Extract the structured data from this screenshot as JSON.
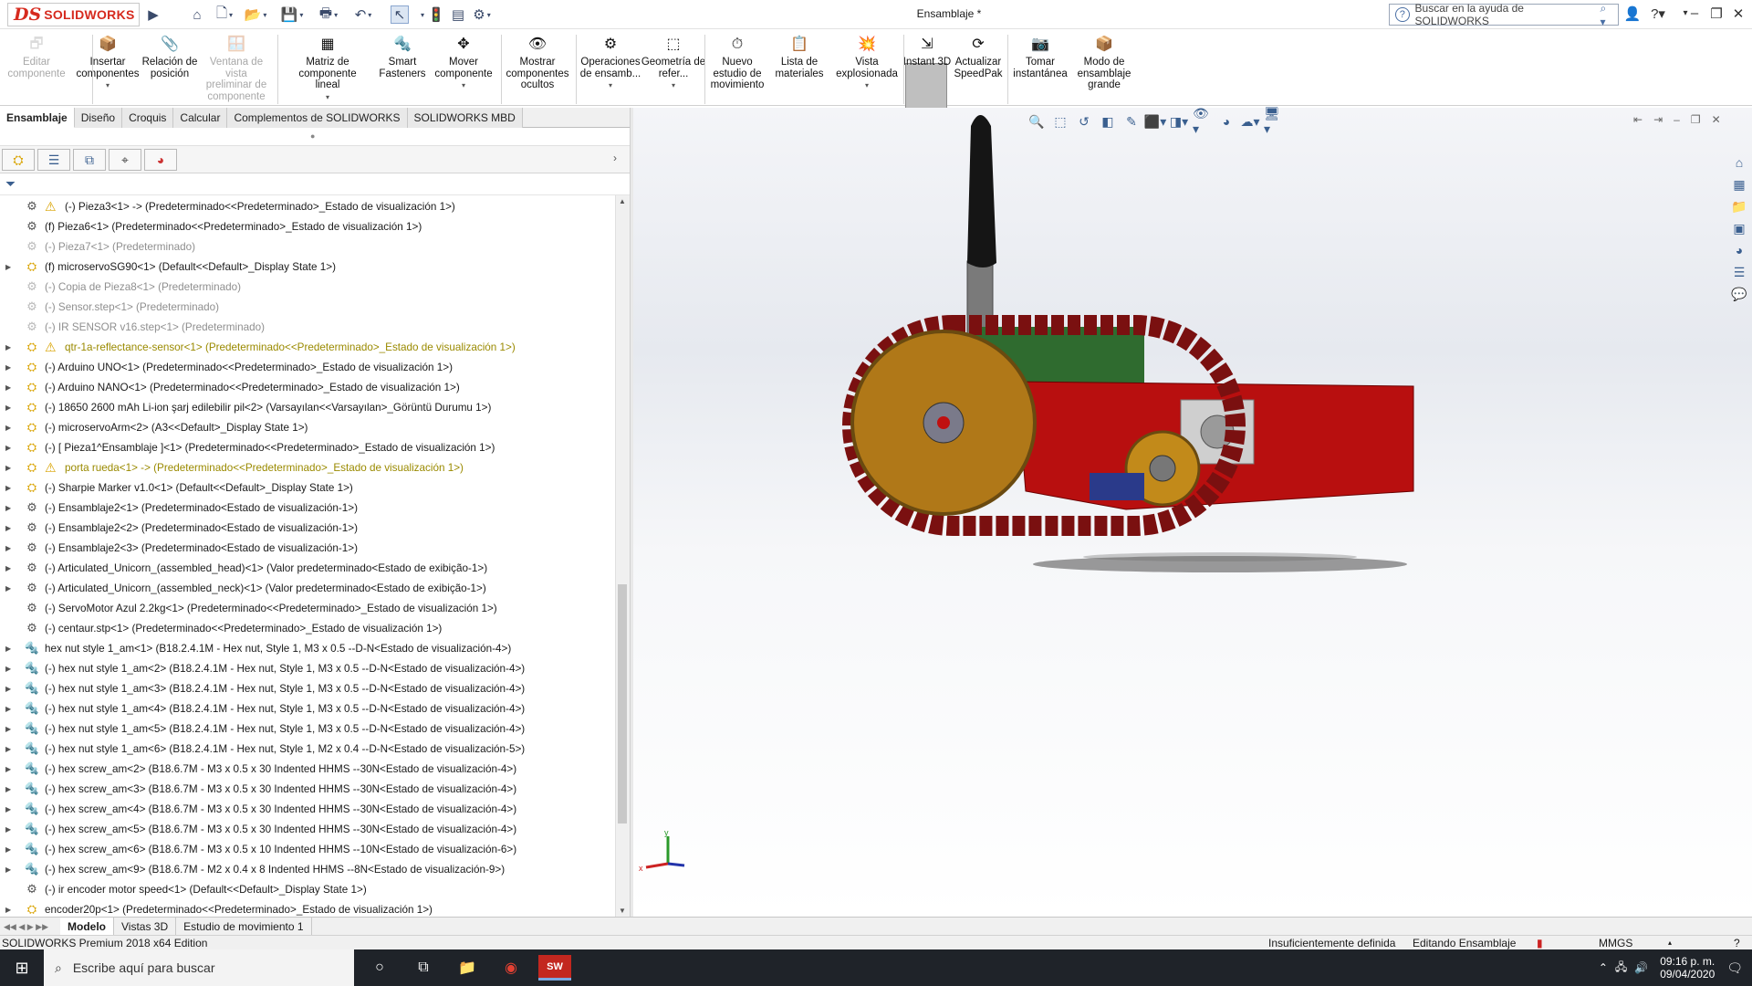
{
  "app": {
    "logo_ds": "DS",
    "logo_text": "SOLIDWORKS",
    "doc_title": "Ensamblaje *",
    "search_placeholder": "Buscar en la ayuda de SOLIDWORKS"
  },
  "ribbon": [
    {
      "label": "Editar componente",
      "disabled": true
    },
    {
      "label": "Insertar componentes",
      "arrow": true
    },
    {
      "label": "Relación de posición"
    },
    {
      "label": "Ventana de vista preliminar de componente",
      "disabled": true
    },
    {
      "label": "Matriz de componente lineal",
      "arrow": true
    },
    {
      "label": "Smart Fasteners"
    },
    {
      "label": "Mover componente",
      "arrow": true
    },
    {
      "label": "Mostrar componentes ocultos"
    },
    {
      "label": "Operaciones de ensamb...",
      "arrow": true
    },
    {
      "label": "Geometría de refer...",
      "arrow": true
    },
    {
      "label": "Nuevo estudio de movimiento"
    },
    {
      "label": "Lista de materiales"
    },
    {
      "label": "Vista explosionada",
      "arrow": true
    },
    {
      "label": "Instant 3D",
      "active": true
    },
    {
      "label": "Actualizar SpeedPak"
    },
    {
      "label": "Tomar instantánea"
    },
    {
      "label": "Modo de ensamblaje grande"
    }
  ],
  "cm_tabs": [
    "Ensamblaje",
    "Diseño",
    "Croquis",
    "Calcular",
    "Complementos de SOLIDWORKS",
    "SOLIDWORKS MBD"
  ],
  "tree": [
    {
      "text": "(-) Pieza3<1> -> (Predeterminado<<Predeterminado>_Estado de visualización 1>)",
      "warn_icon": true,
      "exp": false
    },
    {
      "text": "(f) Pieza6<1> (Predeterminado<<Predeterminado>_Estado de visualización 1>)",
      "exp": false
    },
    {
      "text": "(-) Pieza7<1> (Predeterminado)",
      "grey": true,
      "exp": false
    },
    {
      "text": "(f) microservoSG90<1> (Default<<Default>_Display State 1>)",
      "exp": true,
      "asm": true
    },
    {
      "text": "(-) Copia de Pieza8<1> (Predeterminado)",
      "grey": true,
      "exp": false
    },
    {
      "text": "(-) Sensor.step<1> (Predeterminado)",
      "grey": true,
      "exp": false
    },
    {
      "text": "(-) IR  SENSOR v16.step<1> (Predeterminado)",
      "grey": true,
      "exp": false
    },
    {
      "text": "qtr-1a-reflectance-sensor<1> (Predeterminado<<Predeterminado>_Estado de visualización 1>)",
      "warn": true,
      "warn_icon": true,
      "exp": true,
      "asm": true
    },
    {
      "text": "(-) Arduino UNO<1> (Predeterminado<<Predeterminado>_Estado de visualización 1>)",
      "exp": true,
      "asm": true
    },
    {
      "text": "(-) Arduino NANO<1> (Predeterminado<<Predeterminado>_Estado de visualización 1>)",
      "exp": true,
      "asm": true
    },
    {
      "text": "(-) 18650 2600 mAh Li-ion şarj edilebilir pil<2> (Varsayılan<<Varsayılan>_Görüntü Durumu 1>)",
      "exp": true,
      "asm": true
    },
    {
      "text": "(-) microservoArm<2> (A3<<Default>_Display State 1>)",
      "exp": true,
      "asm": true
    },
    {
      "text": "(-) [ Pieza1^Ensamblaje ]<1> (Predeterminado<<Predeterminado>_Estado de visualización 1>)",
      "exp": true,
      "asm": true
    },
    {
      "text": "porta rueda<1> -> (Predeterminado<<Predeterminado>_Estado de visualización 1>)",
      "warn": true,
      "warn_icon": true,
      "exp": true,
      "asm": true
    },
    {
      "text": "(-) Sharpie Marker v1.0<1> (Default<<Default>_Display State 1>)",
      "exp": true,
      "asm": true
    },
    {
      "text": "(-) Ensamblaje2<1> (Predeterminado<Estado de visualización-1>)",
      "exp": true
    },
    {
      "text": "(-) Ensamblaje2<2> (Predeterminado<Estado de visualización-1>)",
      "exp": true
    },
    {
      "text": "(-) Ensamblaje2<3> (Predeterminado<Estado de visualización-1>)",
      "exp": true
    },
    {
      "text": "(-) Articulated_Unicorn_(assembled_head)<1> (Valor predeterminado<Estado de exibição-1>)",
      "exp": true
    },
    {
      "text": "(-) Articulated_Unicorn_(assembled_neck)<1> (Valor predeterminado<Estado de exibição-1>)",
      "exp": true
    },
    {
      "text": "(-) ServoMotor Azul 2.2kg<1> (Predeterminado<<Predeterminado>_Estado de visualización 1>)",
      "exp": false
    },
    {
      "text": "(-) centaur.stp<1> (Predeterminado<<Predeterminado>_Estado de visualización 1>)",
      "exp": false
    },
    {
      "text": "hex nut style 1_am<1> (B18.2.4.1M - Hex nut, Style 1,  M3 x 0.5 --D-N<Estado de visualización-4>)",
      "exp": true,
      "bolt": true
    },
    {
      "text": "(-) hex nut style 1_am<2> (B18.2.4.1M - Hex nut, Style 1,  M3 x 0.5 --D-N<Estado de visualización-4>)",
      "exp": true,
      "bolt": true
    },
    {
      "text": "(-) hex nut style 1_am<3> (B18.2.4.1M - Hex nut, Style 1,  M3 x 0.5 --D-N<Estado de visualización-4>)",
      "exp": true,
      "bolt": true
    },
    {
      "text": "(-) hex nut style 1_am<4> (B18.2.4.1M - Hex nut, Style 1,  M3 x 0.5 --D-N<Estado de visualización-4>)",
      "exp": true,
      "bolt": true
    },
    {
      "text": "(-) hex nut style 1_am<5> (B18.2.4.1M - Hex nut, Style 1,  M3 x 0.5 --D-N<Estado de visualización-4>)",
      "exp": true,
      "bolt": true
    },
    {
      "text": "(-) hex nut style 1_am<6> (B18.2.4.1M - Hex nut, Style 1,  M2 x 0.4 --D-N<Estado de visualización-5>)",
      "exp": true,
      "bolt": true
    },
    {
      "text": "(-) hex screw_am<2> (B18.6.7M - M3 x 0.5 x 30 Indented HHMS --30N<Estado de visualización-4>)",
      "exp": true,
      "bolt": true
    },
    {
      "text": "(-) hex screw_am<3> (B18.6.7M - M3 x 0.5 x 30 Indented HHMS --30N<Estado de visualización-4>)",
      "exp": true,
      "bolt": true
    },
    {
      "text": "(-) hex screw_am<4> (B18.6.7M - M3 x 0.5 x 30 Indented HHMS --30N<Estado de visualización-4>)",
      "exp": true,
      "bolt": true
    },
    {
      "text": "(-) hex screw_am<5> (B18.6.7M - M3 x 0.5 x 30 Indented HHMS --30N<Estado de visualización-4>)",
      "exp": true,
      "bolt": true
    },
    {
      "text": "(-) hex screw_am<6> (B18.6.7M - M3 x 0.5 x 10 Indented HHMS --10N<Estado de visualización-6>)",
      "exp": true,
      "bolt": true
    },
    {
      "text": "(-) hex screw_am<9> (B18.6.7M - M2 x 0.4 x 8 Indented HHMS --8N<Estado de visualización-9>)",
      "exp": true,
      "bolt": true
    },
    {
      "text": "(-) ir encoder motor speed<1> (Default<<Default>_Display State 1>)",
      "exp": false
    },
    {
      "text": "encoder20p<1> (Predeterminado<<Predeterminado>_Estado de visualización 1>)",
      "exp": true,
      "asm": true
    }
  ],
  "bottom_tabs": [
    "Modelo",
    "Vistas 3D",
    "Estudio de movimiento 1"
  ],
  "status": {
    "edition": "SOLIDWORKS Premium 2018 x64 Edition",
    "definition": "Insuficientemente definida",
    "mode": "Editando Ensamblaje",
    "units": "MMGS"
  },
  "taskbar": {
    "search_placeholder": "Escribe aquí para buscar",
    "time": "09:16 p. m.",
    "date": "09/04/2020"
  },
  "axis": {
    "x": "x",
    "y": "y"
  }
}
